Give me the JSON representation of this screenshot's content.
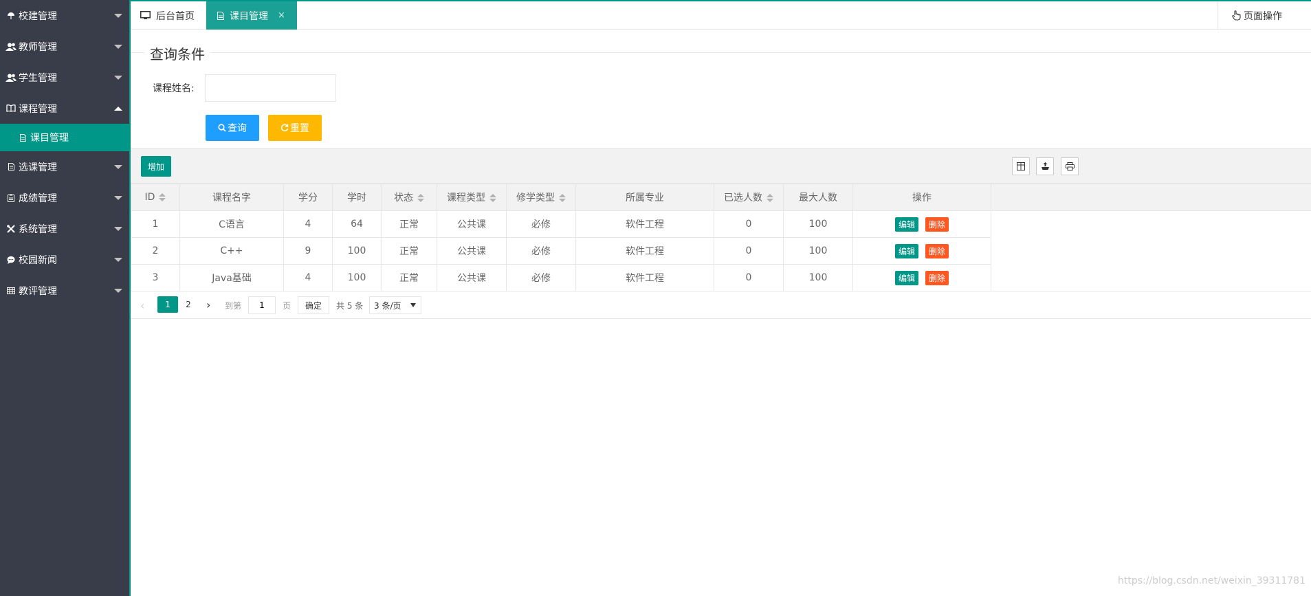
{
  "sidebar": {
    "items": [
      {
        "label": "校建管理",
        "icon": "umbrella-icon"
      },
      {
        "label": "教师管理",
        "icon": "users-icon"
      },
      {
        "label": "学生管理",
        "icon": "users-icon"
      },
      {
        "label": "课程管理",
        "icon": "book-icon"
      },
      {
        "label": "选课管理",
        "icon": "file-icon"
      },
      {
        "label": "成绩管理",
        "icon": "clipboard-icon"
      },
      {
        "label": "系统管理",
        "icon": "tools-icon"
      },
      {
        "label": "校园新闻",
        "icon": "chat-icon"
      },
      {
        "label": "教评管理",
        "icon": "grid-icon"
      }
    ],
    "active_sub": {
      "label": "课目管理",
      "icon": "file-icon"
    }
  },
  "tabs": {
    "home": "后台首页",
    "course": "课目管理",
    "close": "×",
    "page_ops": "页面操作"
  },
  "query": {
    "legend": "查询条件",
    "label": "课程姓名:",
    "input_value": "",
    "input_placeholder": "",
    "query_button": "查询",
    "reset_button": "重置"
  },
  "toolbar": {
    "add_button": "增加"
  },
  "table": {
    "headers": [
      "ID",
      "课程名字",
      "学分",
      "学时",
      "状态",
      "课程类型",
      "修学类型",
      "所属专业",
      "已选人数",
      "最大人数",
      "操作"
    ],
    "rows": [
      [
        "1",
        "C语言",
        "4",
        "64",
        "正常",
        "公共课",
        "必修",
        "软件工程",
        "0",
        "100"
      ],
      [
        "2",
        "C++",
        "9",
        "100",
        "正常",
        "公共课",
        "必修",
        "软件工程",
        "0",
        "100"
      ],
      [
        "3",
        "Java基础",
        "4",
        "100",
        "正常",
        "公共课",
        "必修",
        "软件工程",
        "0",
        "100"
      ]
    ],
    "edit_label": "编辑",
    "delete_label": "删除"
  },
  "pagination": {
    "current": "1",
    "page2": "2",
    "goto_label": "到第",
    "goto_value": "1",
    "page_label": "页",
    "confirm": "确定",
    "total": "共 5 条",
    "per_page": "3 条/页"
  },
  "watermark": "https://blog.csdn.net/weixin_39311781",
  "colors": {
    "sidebar_bg": "#393d49",
    "accent": "#009688",
    "tab_active": "#1aa094",
    "query_btn": "#1e9fff",
    "reset_btn": "#ffb800",
    "delete_btn": "#ff5722"
  }
}
